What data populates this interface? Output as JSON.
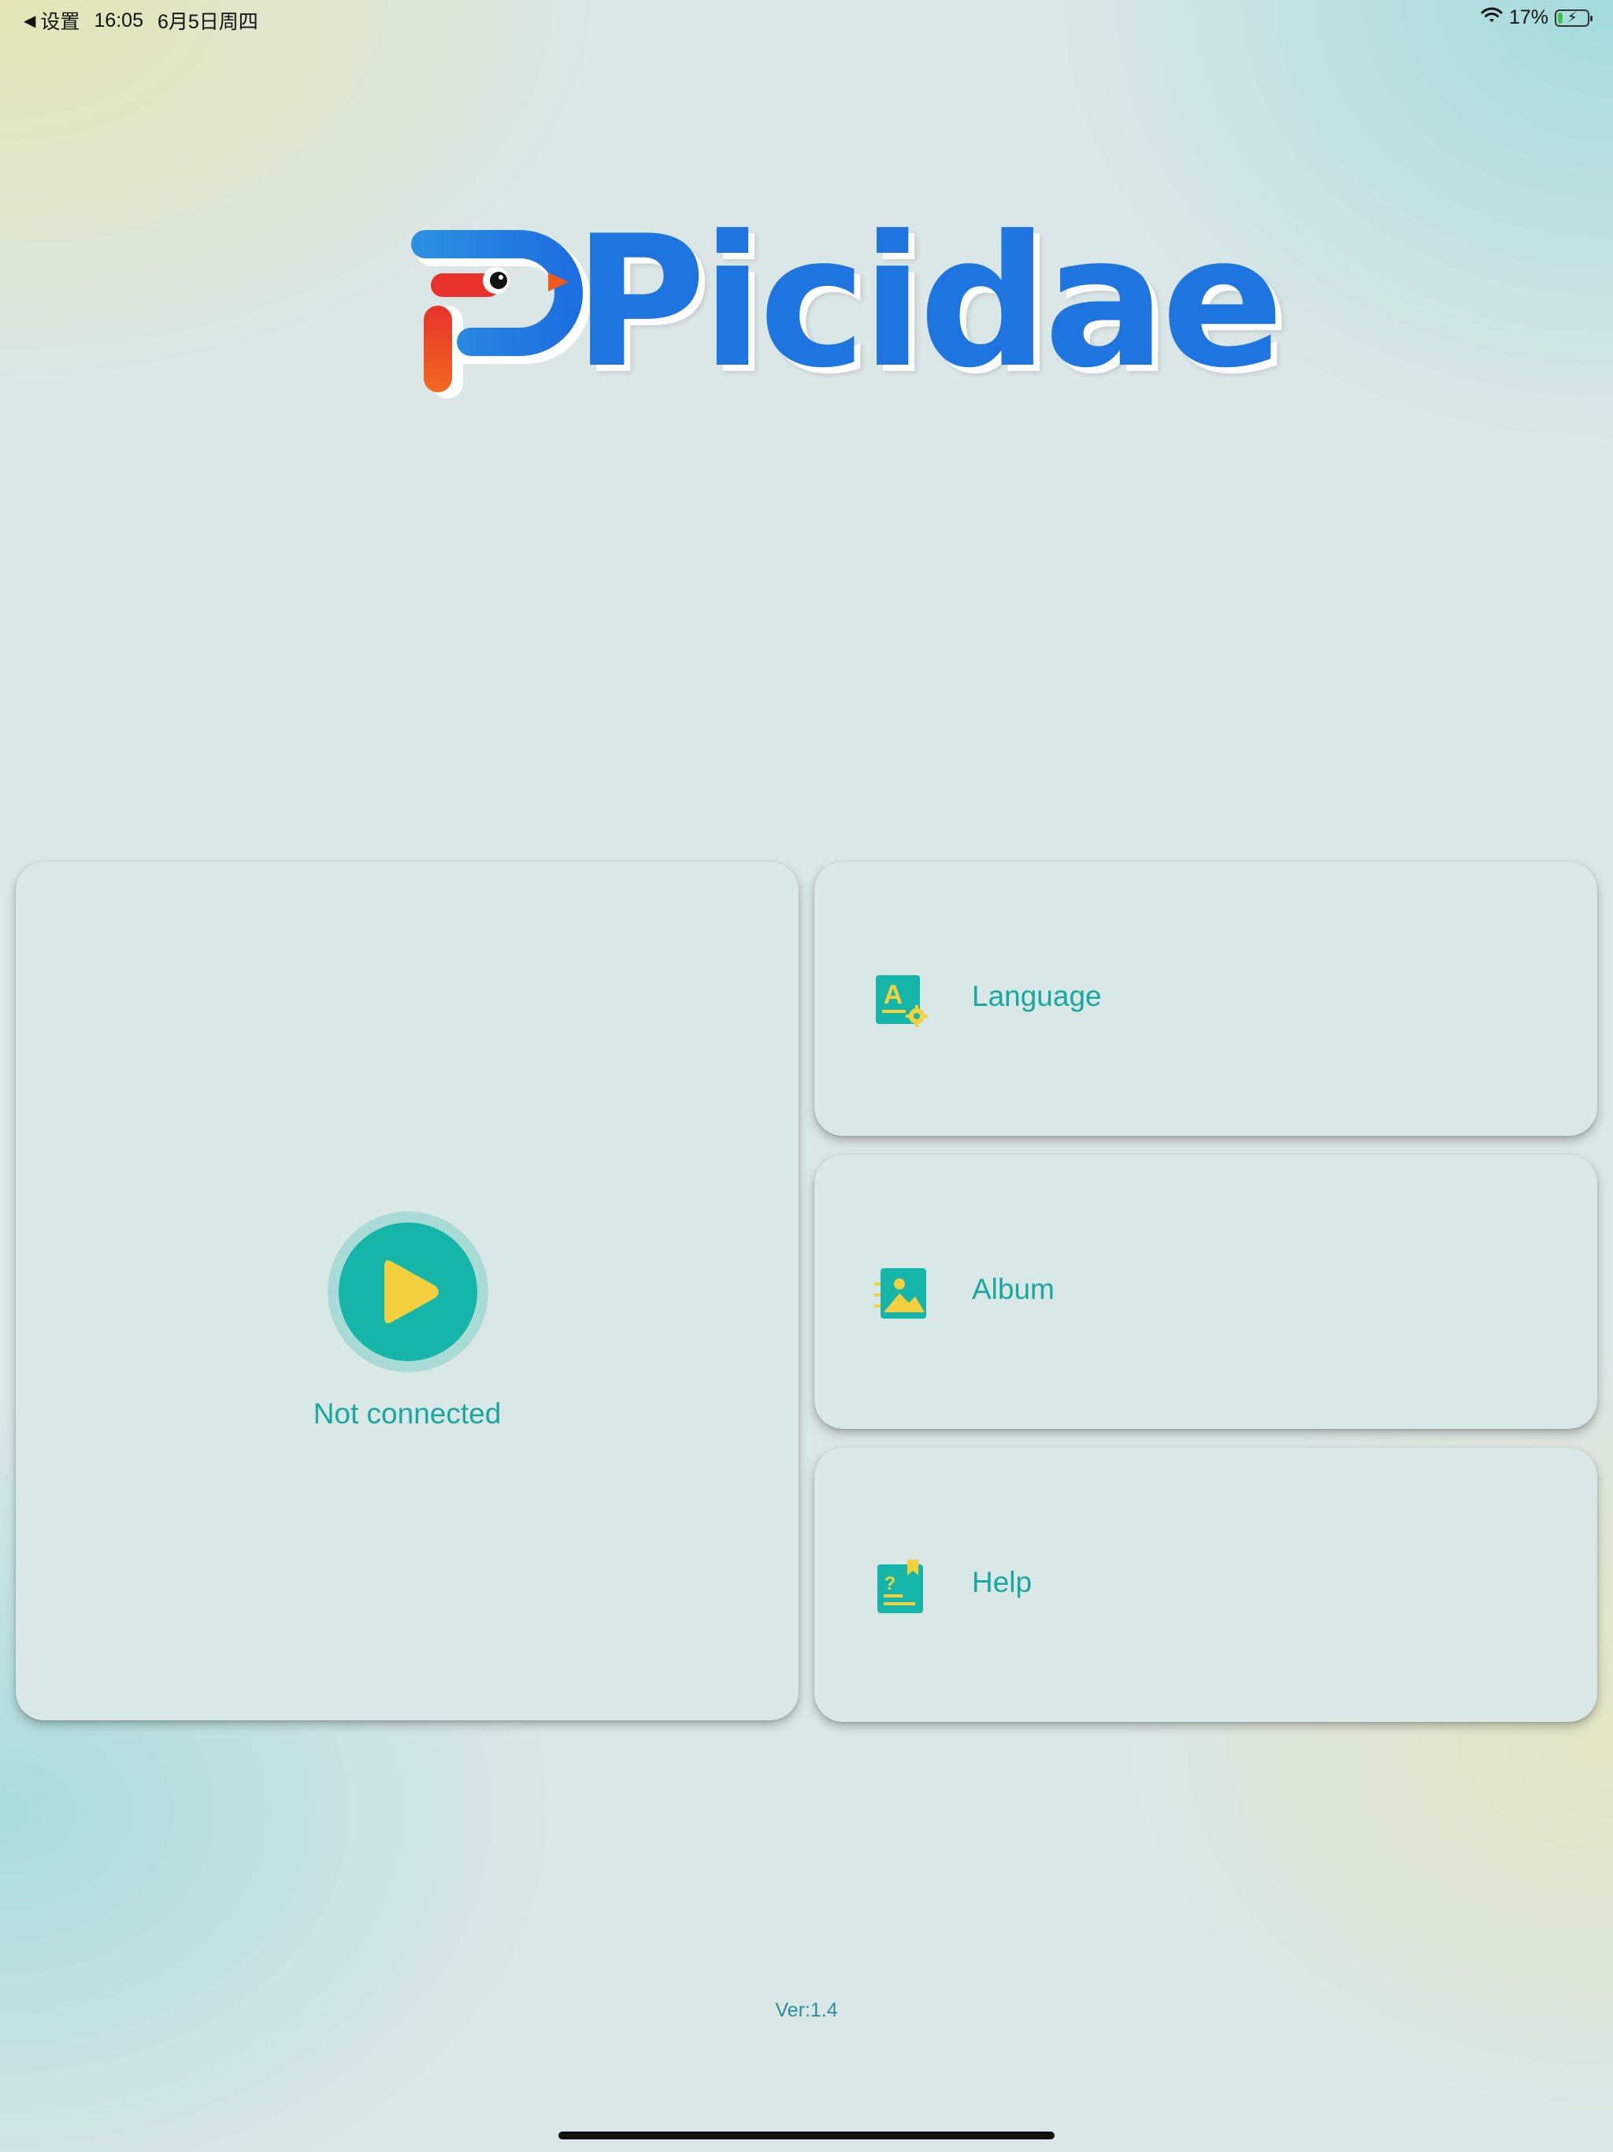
{
  "status_bar": {
    "back_label": "设置",
    "time": "16:05",
    "date": "6月5日周四",
    "battery_percent": "17%",
    "battery_level": 0.17
  },
  "logo": {
    "text": "Picidae"
  },
  "main_card": {
    "status_text": "Not connected",
    "play_icon": "play-icon"
  },
  "menu": [
    {
      "label": "Language",
      "icon": "language-settings-icon"
    },
    {
      "label": "Album",
      "icon": "album-image-icon"
    },
    {
      "label": "Help",
      "icon": "help-book-icon"
    }
  ],
  "footer": {
    "version": "Ver:1.4"
  },
  "colors": {
    "accent_teal": "#15b5aa",
    "text_teal": "#18a89e",
    "logo_blue": "#1e75e0",
    "icon_yellow": "#f4d03f"
  }
}
